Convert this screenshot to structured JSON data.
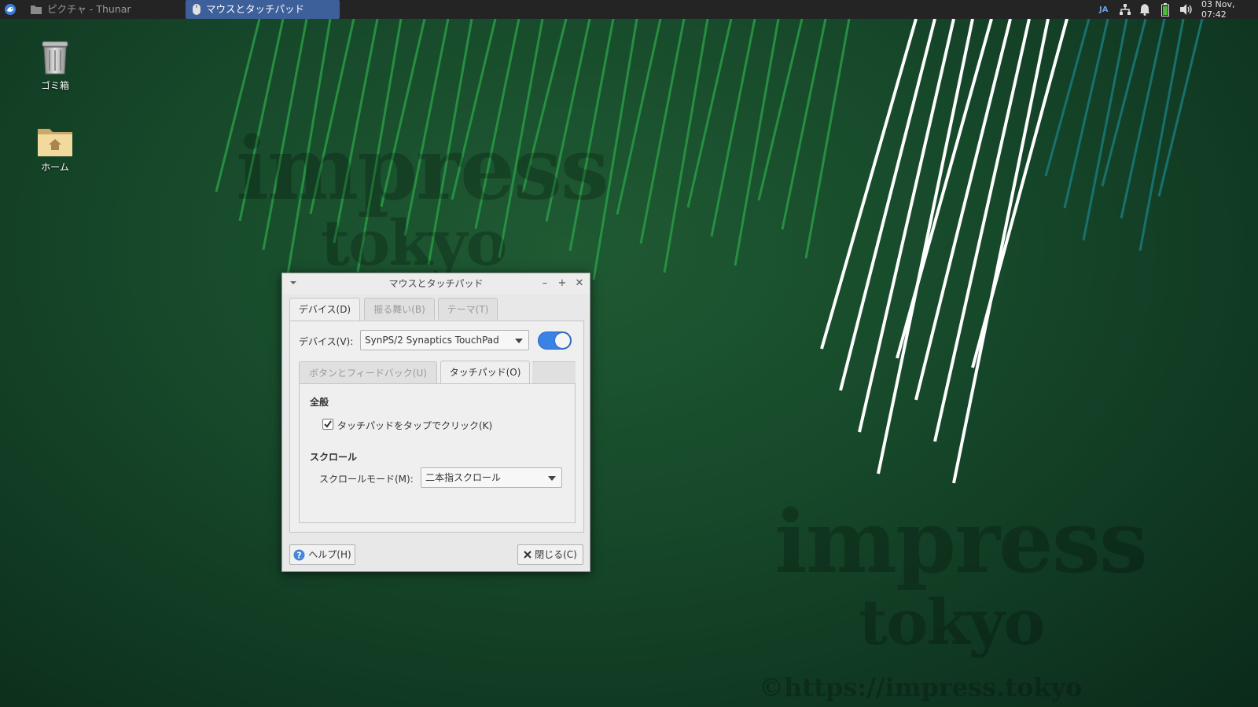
{
  "panel": {
    "tasks": [
      {
        "label": "ピクチャ - Thunar",
        "active": false
      },
      {
        "label": "マウスとタッチパッド",
        "active": true
      }
    ],
    "keyboard_layout": "JA",
    "clock": "03 Nov, 07:42"
  },
  "desktop": {
    "icons": [
      {
        "label": "ゴミ箱"
      },
      {
        "label": "ホーム"
      }
    ],
    "watermark": {
      "line1": "impress",
      "line2": "tokyo",
      "url": "©https://impress.tokyo"
    }
  },
  "dialog": {
    "title": "マウスとタッチパッド",
    "tabs": [
      {
        "label": "デバイス(D)",
        "active": true
      },
      {
        "label": "振る舞い(B)",
        "active": false
      },
      {
        "label": "テーマ(T)",
        "active": false
      }
    ],
    "device_label": "デバイス(V):",
    "device_value": "SynPS/2 Synaptics TouchPad",
    "device_enabled": true,
    "subtabs": [
      {
        "label": "ボタンとフィードバック(U)",
        "active": false
      },
      {
        "label": "タッチパッド(O)",
        "active": true
      }
    ],
    "general_heading": "全般",
    "tap_click_label": "タッチパッドをタップでクリック(K)",
    "tap_click_checked": true,
    "scroll_heading": "スクロール",
    "scroll_mode_label": "スクロールモード(M):",
    "scroll_mode_value": "二本指スクロール",
    "help_label": "ヘルプ(H)",
    "close_label": "閉じる(C)"
  },
  "colors": {
    "panel_bg": "#242424",
    "active_task": "#3d5f9a",
    "toggle_on": "#3b82e6",
    "wallpaper_green": "#174a2b"
  }
}
